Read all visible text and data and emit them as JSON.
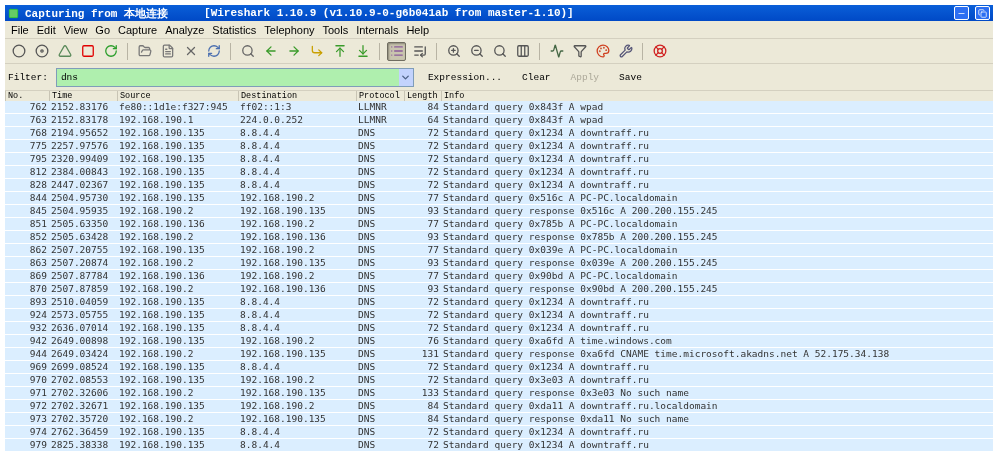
{
  "window": {
    "title": "Capturing from 本地连接",
    "subtitle": "[Wireshark 1.10.9  (v1.10.9-0-g6b041ab from master-1.10)]"
  },
  "menu": [
    "File",
    "Edit",
    "View",
    "Go",
    "Capture",
    "Analyze",
    "Statistics",
    "Telephony",
    "Tools",
    "Internals",
    "Help"
  ],
  "toolbar": [
    {
      "buttons": [
        {
          "kind": "interfaces",
          "pressed": false
        },
        {
          "kind": "options",
          "pressed": false
        },
        {
          "kind": "start",
          "pressed": false
        },
        {
          "kind": "stop",
          "pressed": false
        },
        {
          "kind": "restart",
          "pressed": false
        }
      ]
    },
    {
      "buttons": [
        {
          "kind": "open",
          "pressed": false
        },
        {
          "kind": "save",
          "pressed": false
        },
        {
          "kind": "close",
          "pressed": false
        },
        {
          "kind": "reload",
          "pressed": false
        }
      ]
    },
    {
      "buttons": [
        {
          "kind": "find",
          "pressed": false
        },
        {
          "kind": "back",
          "pressed": false
        },
        {
          "kind": "forward",
          "pressed": false
        },
        {
          "kind": "goto",
          "pressed": false
        },
        {
          "kind": "first",
          "pressed": false
        },
        {
          "kind": "last",
          "pressed": false
        }
      ]
    },
    {
      "buttons": [
        {
          "kind": "colorize",
          "pressed": true
        },
        {
          "kind": "autoscroll",
          "pressed": false
        }
      ]
    },
    {
      "buttons": [
        {
          "kind": "zoom-in",
          "pressed": false
        },
        {
          "kind": "zoom-out",
          "pressed": false
        },
        {
          "kind": "zoom-reset",
          "pressed": false
        },
        {
          "kind": "resize",
          "pressed": false
        }
      ]
    },
    {
      "buttons": [
        {
          "kind": "capture-filter",
          "pressed": false
        },
        {
          "kind": "display-filter",
          "pressed": false
        },
        {
          "kind": "coloring",
          "pressed": false
        },
        {
          "kind": "prefs",
          "pressed": false
        }
      ]
    },
    {
      "buttons": [
        {
          "kind": "help",
          "pressed": false
        }
      ]
    }
  ],
  "filter": {
    "label": "Filter:",
    "value": "dns",
    "buttons": [
      {
        "label": "Expression...",
        "disabled": false
      },
      {
        "label": "Clear",
        "disabled": false
      },
      {
        "label": "Apply",
        "disabled": true
      },
      {
        "label": "Save",
        "disabled": false
      }
    ]
  },
  "table": {
    "columns": [
      "No.",
      "Time",
      "Source",
      "Destination",
      "Protocol",
      "Length",
      "Info"
    ],
    "rows": [
      [
        "762",
        "2152.83176",
        "fe80::1d1e:f327:945",
        "ff02::1:3",
        "LLMNR",
        "84",
        "Standard query 0x843f  A wpad"
      ],
      [
        "763",
        "2152.83178",
        "192.168.190.1",
        "224.0.0.252",
        "LLMNR",
        "64",
        "Standard query 0x843f  A wpad"
      ],
      [
        "768",
        "2194.95652",
        "192.168.190.135",
        "8.8.4.4",
        "DNS",
        "72",
        "Standard query 0x1234  A downtraff.ru"
      ],
      [
        "775",
        "2257.97576",
        "192.168.190.135",
        "8.8.4.4",
        "DNS",
        "72",
        "Standard query 0x1234  A downtraff.ru"
      ],
      [
        "795",
        "2320.99409",
        "192.168.190.135",
        "8.8.4.4",
        "DNS",
        "72",
        "Standard query 0x1234  A downtraff.ru"
      ],
      [
        "812",
        "2384.00843",
        "192.168.190.135",
        "8.8.4.4",
        "DNS",
        "72",
        "Standard query 0x1234  A downtraff.ru"
      ],
      [
        "828",
        "2447.02367",
        "192.168.190.135",
        "8.8.4.4",
        "DNS",
        "72",
        "Standard query 0x1234  A downtraff.ru"
      ],
      [
        "844",
        "2504.95730",
        "192.168.190.135",
        "192.168.190.2",
        "DNS",
        "77",
        "Standard query 0x516c  A PC-PC.localdomain"
      ],
      [
        "845",
        "2504.95935",
        "192.168.190.2",
        "192.168.190.135",
        "DNS",
        "93",
        "Standard query response 0x516c  A 200.200.155.245"
      ],
      [
        "851",
        "2505.63350",
        "192.168.190.136",
        "192.168.190.2",
        "DNS",
        "77",
        "Standard query 0x785b  A PC-PC.localdomain"
      ],
      [
        "852",
        "2505.63428",
        "192.168.190.2",
        "192.168.190.136",
        "DNS",
        "93",
        "Standard query response 0x785b  A 200.200.155.245"
      ],
      [
        "862",
        "2507.20755",
        "192.168.190.135",
        "192.168.190.2",
        "DNS",
        "77",
        "Standard query 0x039e  A PC-PC.localdomain"
      ],
      [
        "863",
        "2507.20874",
        "192.168.190.2",
        "192.168.190.135",
        "DNS",
        "93",
        "Standard query response 0x039e  A 200.200.155.245"
      ],
      [
        "869",
        "2507.87784",
        "192.168.190.136",
        "192.168.190.2",
        "DNS",
        "77",
        "Standard query 0x90bd  A PC-PC.localdomain"
      ],
      [
        "870",
        "2507.87859",
        "192.168.190.2",
        "192.168.190.136",
        "DNS",
        "93",
        "Standard query response 0x90bd  A 200.200.155.245"
      ],
      [
        "893",
        "2510.04059",
        "192.168.190.135",
        "8.8.4.4",
        "DNS",
        "72",
        "Standard query 0x1234  A downtraff.ru"
      ],
      [
        "924",
        "2573.05755",
        "192.168.190.135",
        "8.8.4.4",
        "DNS",
        "72",
        "Standard query 0x1234  A downtraff.ru"
      ],
      [
        "932",
        "2636.07014",
        "192.168.190.135",
        "8.8.4.4",
        "DNS",
        "72",
        "Standard query 0x1234  A downtraff.ru"
      ],
      [
        "942",
        "2649.00898",
        "192.168.190.135",
        "192.168.190.2",
        "DNS",
        "76",
        "Standard query 0xa6fd  A time.windows.com"
      ],
      [
        "944",
        "2649.03424",
        "192.168.190.2",
        "192.168.190.135",
        "DNS",
        "131",
        "Standard query response 0xa6fd  CNAME time.microsoft.akadns.net A 52.175.34.138"
      ],
      [
        "969",
        "2699.08524",
        "192.168.190.135",
        "8.8.4.4",
        "DNS",
        "72",
        "Standard query 0x1234  A downtraff.ru"
      ],
      [
        "970",
        "2702.08553",
        "192.168.190.135",
        "192.168.190.2",
        "DNS",
        "72",
        "Standard query 0x3e03  A downtraff.ru"
      ],
      [
        "971",
        "2702.32606",
        "192.168.190.2",
        "192.168.190.135",
        "DNS",
        "133",
        "Standard query response 0x3e03 No such name"
      ],
      [
        "972",
        "2702.32671",
        "192.168.190.135",
        "192.168.190.2",
        "DNS",
        "84",
        "Standard query 0xda11  A downtraff.ru.localdomain"
      ],
      [
        "973",
        "2702.35720",
        "192.168.190.2",
        "192.168.190.135",
        "DNS",
        "84",
        "Standard query response 0xda11 No such name"
      ],
      [
        "974",
        "2762.36459",
        "192.168.190.135",
        "8.8.4.4",
        "DNS",
        "72",
        "Standard query 0x1234  A downtraff.ru"
      ],
      [
        "979",
        "2825.38338",
        "192.168.190.135",
        "8.8.4.4",
        "DNS",
        "72",
        "Standard query 0x1234  A downtraff.ru"
      ]
    ]
  }
}
